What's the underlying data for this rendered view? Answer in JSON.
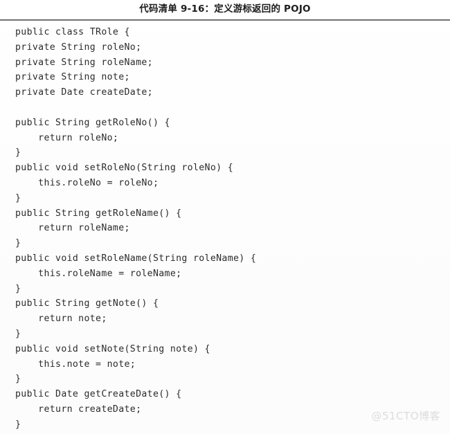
{
  "document": {
    "caption": "代码清单 9-16：定义游标返回的 POJO",
    "watermark": "@51CTO博客",
    "rule_color": "#4a4a4a",
    "text_color": "#2b2b2b",
    "background_color": "#fefefe",
    "watermark_color": "#dcdcdc"
  },
  "code": {
    "language": "java",
    "lines": [
      "public class TRole {",
      "private String roleNo;",
      "private String roleName;",
      "private String note;",
      "private Date createDate;",
      "",
      "public String getRoleNo() {",
      "    return roleNo;",
      "}",
      "public void setRoleNo(String roleNo) {",
      "    this.roleNo = roleNo;",
      "}",
      "public String getRoleName() {",
      "    return roleName;",
      "}",
      "public void setRoleName(String roleName) {",
      "    this.roleName = roleName;",
      "}",
      "public String getNote() {",
      "    return note;",
      "}",
      "public void setNote(String note) {",
      "    this.note = note;",
      "}",
      "public Date getCreateDate() {",
      "    return createDate;",
      "}"
    ]
  }
}
